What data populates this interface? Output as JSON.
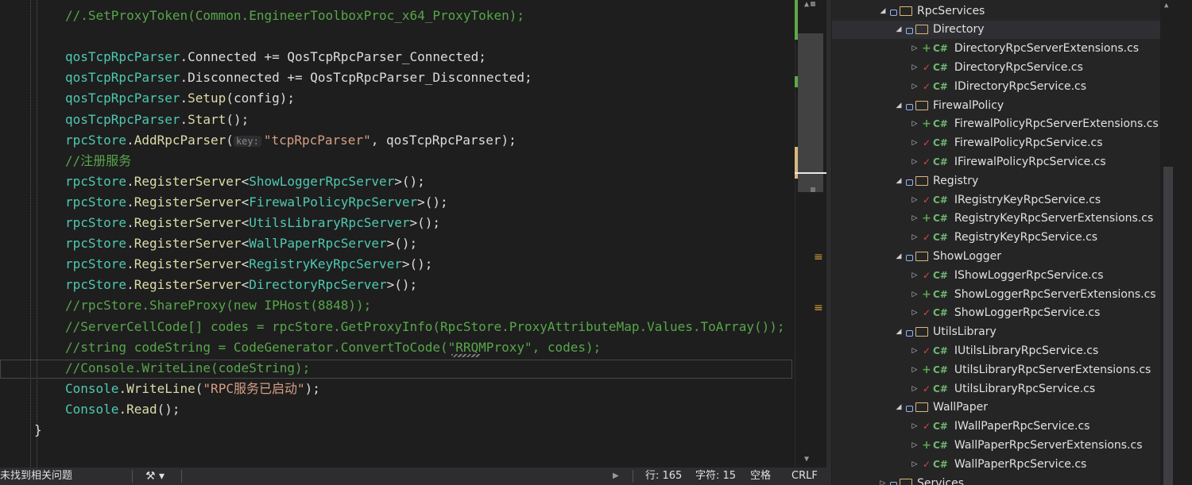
{
  "editor": {
    "lines": [
      [
        {
          "c": "cm",
          "t": "//.SetProxyToken(Common.EngineerToolboxProc_x64_ProxyToken);"
        }
      ],
      [],
      [
        {
          "c": "id",
          "t": "qosTcpRpcParser"
        },
        {
          "c": "pl",
          "t": "."
        },
        {
          "c": "pl",
          "t": "Connected"
        },
        {
          "c": "pl",
          "t": " += "
        },
        {
          "c": "pl",
          "t": "QosTcpRpcParser_Connected"
        },
        {
          "c": "pl",
          "t": ";"
        }
      ],
      [
        {
          "c": "id",
          "t": "qosTcpRpcParser"
        },
        {
          "c": "pl",
          "t": "."
        },
        {
          "c": "pl",
          "t": "Disconnected"
        },
        {
          "c": "pl",
          "t": " += "
        },
        {
          "c": "pl",
          "t": "QosTcpRpcParser_Disconnected"
        },
        {
          "c": "pl",
          "t": ";"
        }
      ],
      [
        {
          "c": "id",
          "t": "qosTcpRpcParser"
        },
        {
          "c": "pl",
          "t": "."
        },
        {
          "c": "mt",
          "t": "Setup"
        },
        {
          "c": "pl",
          "t": "(config);"
        }
      ],
      [
        {
          "c": "id",
          "t": "qosTcpRpcParser"
        },
        {
          "c": "pl",
          "t": "."
        },
        {
          "c": "mt",
          "t": "Start"
        },
        {
          "c": "pl",
          "t": "();"
        }
      ],
      [
        {
          "c": "id",
          "t": "rpcStore"
        },
        {
          "c": "pl",
          "t": "."
        },
        {
          "c": "mt",
          "t": "AddRpcParser"
        },
        {
          "c": "pl",
          "t": "("
        },
        {
          "c": "hint",
          "t": "key:"
        },
        {
          "c": "st",
          "t": "\"tcpRpcParser\""
        },
        {
          "c": "pl",
          "t": ", qosTcpRpcParser);"
        }
      ],
      [
        {
          "c": "cm",
          "t": "//注册服务"
        }
      ],
      [
        {
          "c": "id",
          "t": "rpcStore"
        },
        {
          "c": "pl",
          "t": "."
        },
        {
          "c": "mt",
          "t": "RegisterServer"
        },
        {
          "c": "pl",
          "t": "<"
        },
        {
          "c": "id",
          "t": "ShowLoggerRpcServer"
        },
        {
          "c": "pl",
          "t": ">();"
        }
      ],
      [
        {
          "c": "id",
          "t": "rpcStore"
        },
        {
          "c": "pl",
          "t": "."
        },
        {
          "c": "mt",
          "t": "RegisterServer"
        },
        {
          "c": "pl",
          "t": "<"
        },
        {
          "c": "id",
          "t": "FirewalPolicyRpcServer"
        },
        {
          "c": "pl",
          "t": ">();"
        }
      ],
      [
        {
          "c": "id",
          "t": "rpcStore"
        },
        {
          "c": "pl",
          "t": "."
        },
        {
          "c": "mt",
          "t": "RegisterServer"
        },
        {
          "c": "pl",
          "t": "<"
        },
        {
          "c": "id",
          "t": "UtilsLibraryRpcServer"
        },
        {
          "c": "pl",
          "t": ">();"
        }
      ],
      [
        {
          "c": "id",
          "t": "rpcStore"
        },
        {
          "c": "pl",
          "t": "."
        },
        {
          "c": "mt",
          "t": "RegisterServer"
        },
        {
          "c": "pl",
          "t": "<"
        },
        {
          "c": "id",
          "t": "WallPaperRpcServer"
        },
        {
          "c": "pl",
          "t": ">();"
        }
      ],
      [
        {
          "c": "id",
          "t": "rpcStore"
        },
        {
          "c": "pl",
          "t": "."
        },
        {
          "c": "mt",
          "t": "RegisterServer"
        },
        {
          "c": "pl",
          "t": "<"
        },
        {
          "c": "id",
          "t": "RegistryKeyRpcServer"
        },
        {
          "c": "pl",
          "t": ">();"
        }
      ],
      [
        {
          "c": "id",
          "t": "rpcStore"
        },
        {
          "c": "pl",
          "t": "."
        },
        {
          "c": "mt",
          "t": "RegisterServer"
        },
        {
          "c": "pl",
          "t": "<"
        },
        {
          "c": "id",
          "t": "DirectoryRpcServer"
        },
        {
          "c": "pl",
          "t": ">();"
        }
      ],
      [
        {
          "c": "cm",
          "t": "//rpcStore.ShareProxy(new IPHost(8848));"
        }
      ],
      [
        {
          "c": "cm",
          "t": "//ServerCellCode[] codes = rpcStore.GetProxyInfo(RpcStore.ProxyAttributeMap.Values.ToArray());"
        }
      ],
      [
        {
          "c": "cm",
          "t": "//string codeString = CodeGenerator.ConvertToCode(\"RRQMProxy\", codes);"
        }
      ],
      [
        {
          "c": "cm",
          "t": "//Console.WriteLine(codeString);"
        }
      ],
      [
        {
          "c": "id",
          "t": "Console"
        },
        {
          "c": "pl",
          "t": "."
        },
        {
          "c": "mt",
          "t": "WriteLine"
        },
        {
          "c": "pl",
          "t": "("
        },
        {
          "c": "st",
          "t": "\"RPC服务已启动\""
        },
        {
          "c": "pl",
          "t": ");"
        }
      ],
      [
        {
          "c": "id",
          "t": "Console"
        },
        {
          "c": "pl",
          "t": "."
        },
        {
          "c": "mt",
          "t": "Read"
        },
        {
          "c": "pl",
          "t": "();"
        }
      ],
      [
        {
          "c": "pl",
          "t": "}"
        }
      ]
    ]
  },
  "solution_tree": {
    "items": [
      {
        "kind": "folder",
        "label": "RpcServices",
        "level": 0
      },
      {
        "kind": "folder",
        "label": "Directory",
        "level": 1,
        "selected": true
      },
      {
        "kind": "file",
        "label": "DirectoryRpcServerExtensions.cs",
        "level": 2,
        "status": "added"
      },
      {
        "kind": "file",
        "label": "DirectoryRpcService.cs",
        "level": 2,
        "status": "checked"
      },
      {
        "kind": "file",
        "label": "IDirectoryRpcService.cs",
        "level": 2,
        "status": "checked"
      },
      {
        "kind": "folder",
        "label": "FirewalPolicy",
        "level": 1
      },
      {
        "kind": "file",
        "label": "FirewalPolicyRpcServerExtensions.cs",
        "level": 2,
        "status": "added"
      },
      {
        "kind": "file",
        "label": "FirewalPolicyRpcService.cs",
        "level": 2,
        "status": "checked"
      },
      {
        "kind": "file",
        "label": "IFirewalPolicyRpcService.cs",
        "level": 2,
        "status": "checked"
      },
      {
        "kind": "folder",
        "label": "Registry",
        "level": 1
      },
      {
        "kind": "file",
        "label": "IRegistryKeyRpcService.cs",
        "level": 2,
        "status": "checked"
      },
      {
        "kind": "file",
        "label": "RegistryKeyRpcServerExtensions.cs",
        "level": 2,
        "status": "added"
      },
      {
        "kind": "file",
        "label": "RegistryKeyRpcService.cs",
        "level": 2,
        "status": "checked"
      },
      {
        "kind": "folder",
        "label": "ShowLogger",
        "level": 1
      },
      {
        "kind": "file",
        "label": "IShowLoggerRpcService.cs",
        "level": 2,
        "status": "checked"
      },
      {
        "kind": "file",
        "label": "ShowLoggerRpcServerExtensions.cs",
        "level": 2,
        "status": "added"
      },
      {
        "kind": "file",
        "label": "ShowLoggerRpcService.cs",
        "level": 2,
        "status": "checked"
      },
      {
        "kind": "folder",
        "label": "UtilsLibrary",
        "level": 1
      },
      {
        "kind": "file",
        "label": "IUtilsLibraryRpcService.cs",
        "level": 2,
        "status": "checked"
      },
      {
        "kind": "file",
        "label": "UtilsLibraryRpcServerExtensions.cs",
        "level": 2,
        "status": "added"
      },
      {
        "kind": "file",
        "label": "UtilsLibraryRpcService.cs",
        "level": 2,
        "status": "checked"
      },
      {
        "kind": "folder",
        "label": "WallPaper",
        "level": 1
      },
      {
        "kind": "file",
        "label": "IWallPaperRpcService.cs",
        "level": 2,
        "status": "checked"
      },
      {
        "kind": "file",
        "label": "WallPaperRpcServerExtensions.cs",
        "level": 2,
        "status": "added"
      },
      {
        "kind": "file",
        "label": "WallPaperRpcService.cs",
        "level": 2,
        "status": "checked"
      },
      {
        "kind": "folder",
        "label": "Services",
        "level": 0,
        "collapsed": true
      }
    ],
    "file_badge": "C#"
  },
  "statusbar": {
    "issues": "未找到相关问题",
    "line": "行: 165",
    "char": "字符: 15",
    "whitespace": "空格",
    "eol": "CRLF"
  }
}
